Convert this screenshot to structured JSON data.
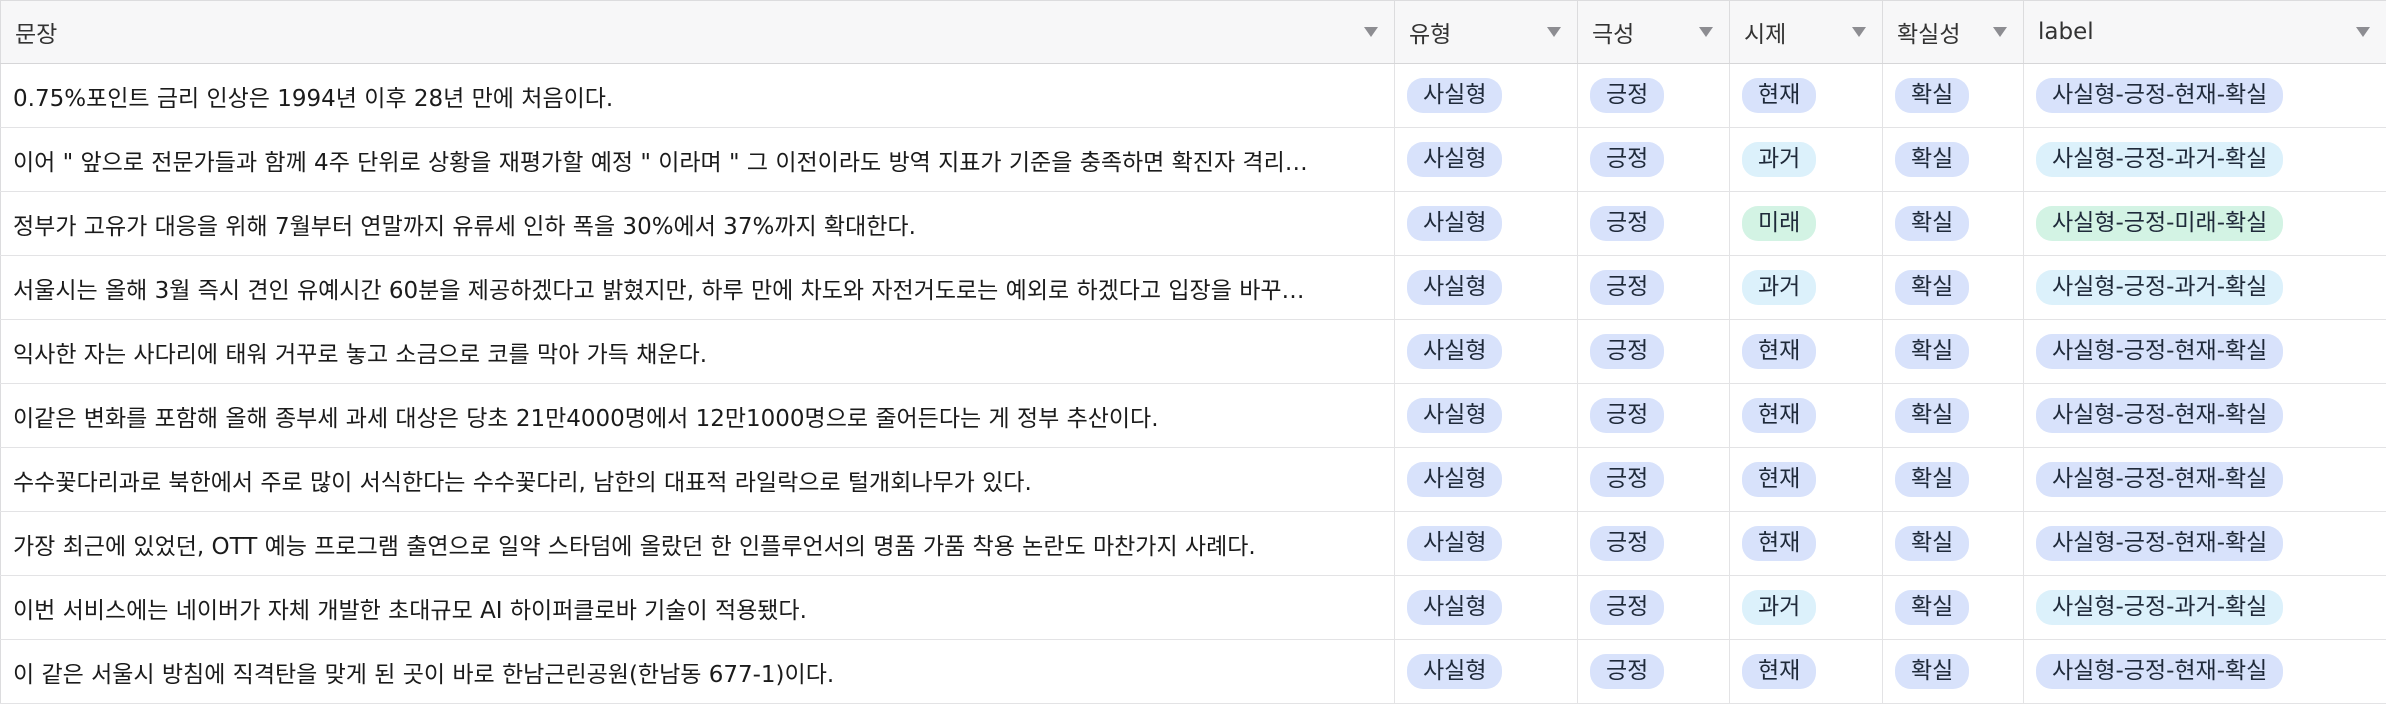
{
  "columns": [
    {
      "label": "문장"
    },
    {
      "label": "유형"
    },
    {
      "label": "극성"
    },
    {
      "label": "시제"
    },
    {
      "label": "확실성"
    },
    {
      "label": "label"
    }
  ],
  "pill_colors": {
    "blue": "#d8e2fb",
    "cyan": "#dcf1fb",
    "green": "#d3f3e4"
  },
  "rows": [
    {
      "sentence": "0.75%포인트 금리 인상은 1994년 이후 28년 만에 처음이다.",
      "type": "사실형",
      "polarity": "긍정",
      "tense": "현재",
      "certainty": "확실",
      "label": "사실형-긍정-현재-확실",
      "tense_color": "blue",
      "label_color": "blue"
    },
    {
      "sentence": "이어 \" 앞으로 전문가들과 함께 4주 단위로 상황을 재평가할 예정 \" 이라며 \" 그 이전이라도 방역 지표가 기준을 충족하면 확진자 격리…",
      "type": "사실형",
      "polarity": "긍정",
      "tense": "과거",
      "certainty": "확실",
      "label": "사실형-긍정-과거-확실",
      "tense_color": "cyan",
      "label_color": "cyan"
    },
    {
      "sentence": "정부가 고유가 대응을 위해 7월부터 연말까지 유류세 인하 폭을 30%에서 37%까지 확대한다.",
      "type": "사실형",
      "polarity": "긍정",
      "tense": "미래",
      "certainty": "확실",
      "label": "사실형-긍정-미래-확실",
      "tense_color": "green",
      "label_color": "green"
    },
    {
      "sentence": "서울시는 올해 3월 즉시 견인 유예시간 60분을 제공하겠다고 밝혔지만, 하루 만에 차도와 자전거도로는 예외로 하겠다고 입장을 바꾸…",
      "type": "사실형",
      "polarity": "긍정",
      "tense": "과거",
      "certainty": "확실",
      "label": "사실형-긍정-과거-확실",
      "tense_color": "cyan",
      "label_color": "cyan"
    },
    {
      "sentence": "익사한 자는 사다리에 태워 거꾸로 놓고 소금으로 코를 막아 가득 채운다.",
      "type": "사실형",
      "polarity": "긍정",
      "tense": "현재",
      "certainty": "확실",
      "label": "사실형-긍정-현재-확실",
      "tense_color": "blue",
      "label_color": "blue"
    },
    {
      "sentence": "이같은 변화를 포함해 올해 종부세 과세 대상은 당초 21만4000명에서 12만1000명으로 줄어든다는 게 정부 추산이다.",
      "type": "사실형",
      "polarity": "긍정",
      "tense": "현재",
      "certainty": "확실",
      "label": "사실형-긍정-현재-확실",
      "tense_color": "blue",
      "label_color": "blue"
    },
    {
      "sentence": "수수꽃다리과로 북한에서 주로 많이 서식한다는 수수꽃다리, 남한의 대표적 라일락으로 털개회나무가 있다.",
      "type": "사실형",
      "polarity": "긍정",
      "tense": "현재",
      "certainty": "확실",
      "label": "사실형-긍정-현재-확실",
      "tense_color": "blue",
      "label_color": "blue"
    },
    {
      "sentence": "가장 최근에 있었던, OTT 예능 프로그램 출연으로 일약 스타덤에 올랐던 한 인플루언서의 명품 가품 착용 논란도 마찬가지 사례다.",
      "type": "사실형",
      "polarity": "긍정",
      "tense": "현재",
      "certainty": "확실",
      "label": "사실형-긍정-현재-확실",
      "tense_color": "blue",
      "label_color": "blue"
    },
    {
      "sentence": "이번 서비스에는 네이버가 자체 개발한 초대규모 AI 하이퍼클로바 기술이 적용됐다.",
      "type": "사실형",
      "polarity": "긍정",
      "tense": "과거",
      "certainty": "확실",
      "label": "사실형-긍정-과거-확실",
      "tense_color": "cyan",
      "label_color": "cyan"
    },
    {
      "sentence": "이 같은 서울시 방침에 직격탄을 맞게 된 곳이 바로 한남근린공원(한남동 677-1)이다.",
      "type": "사실형",
      "polarity": "긍정",
      "tense": "현재",
      "certainty": "확실",
      "label": "사실형-긍정-현재-확실",
      "tense_color": "blue",
      "label_color": "blue"
    }
  ]
}
